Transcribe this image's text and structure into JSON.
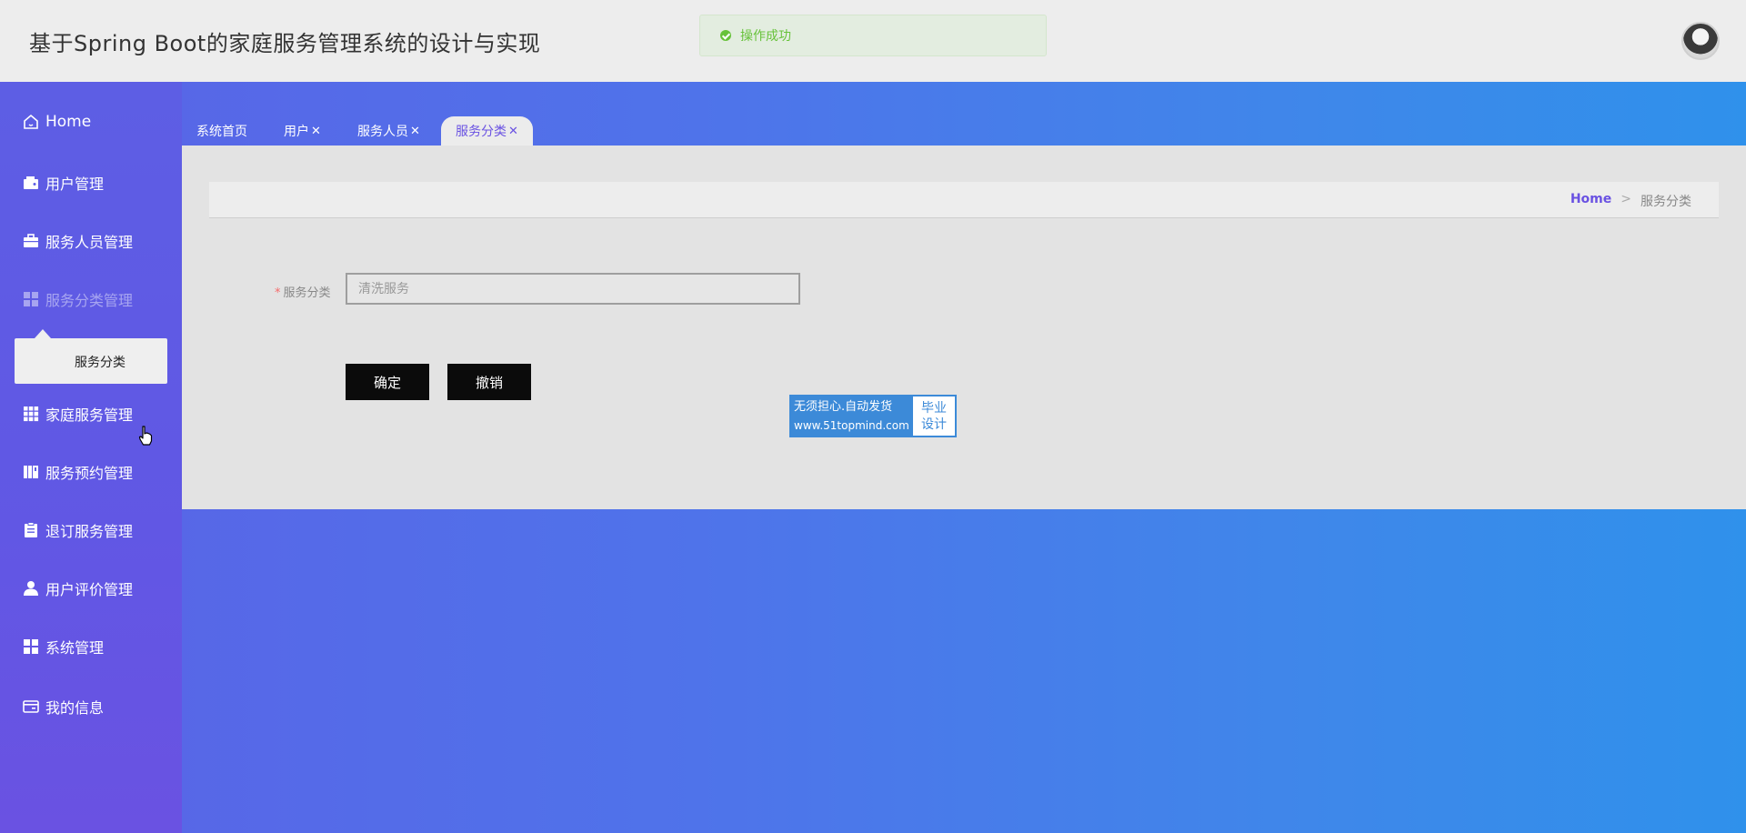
{
  "header": {
    "title": "基于Spring Boot的家庭服务管理系统的设计与实现",
    "toast": "操作成功"
  },
  "sidebar": {
    "items": [
      {
        "label": "Home",
        "icon": "home-icon"
      },
      {
        "label": "用户管理",
        "icon": "wallet-icon"
      },
      {
        "label": "服务人员管理",
        "icon": "briefcase-icon"
      },
      {
        "label": "服务分类管理",
        "icon": "grid-icon"
      },
      {
        "label": "家庭服务管理",
        "icon": "apps-icon"
      },
      {
        "label": "服务预约管理",
        "icon": "book-icon"
      },
      {
        "label": "退订服务管理",
        "icon": "clipboard-icon"
      },
      {
        "label": "用户评价管理",
        "icon": "user-icon"
      },
      {
        "label": "系统管理",
        "icon": "grid-icon"
      },
      {
        "label": "我的信息",
        "icon": "card-icon"
      }
    ],
    "submenu_item": "服务分类"
  },
  "tabs": [
    {
      "label": "系统首页",
      "close": ""
    },
    {
      "label": "用户",
      "close": "✕"
    },
    {
      "label": "服务人员",
      "close": "✕"
    },
    {
      "label": "服务分类",
      "close": "✕"
    }
  ],
  "breadcrumb": {
    "home": "Home",
    "separator": ">",
    "current": "服务分类"
  },
  "form": {
    "label": "服务分类",
    "required_mark": "*",
    "value": "",
    "placeholder": "清洗服务",
    "confirm": "确定",
    "cancel": "撤销"
  },
  "watermark": {
    "line1": "无须担心.自动发货",
    "line2": "www.51topmind.com",
    "right1": "毕业",
    "right2": "设计"
  },
  "colors": {
    "accent": "#6a52e2",
    "success": "#67c23a",
    "button": "#0b0b0b"
  }
}
